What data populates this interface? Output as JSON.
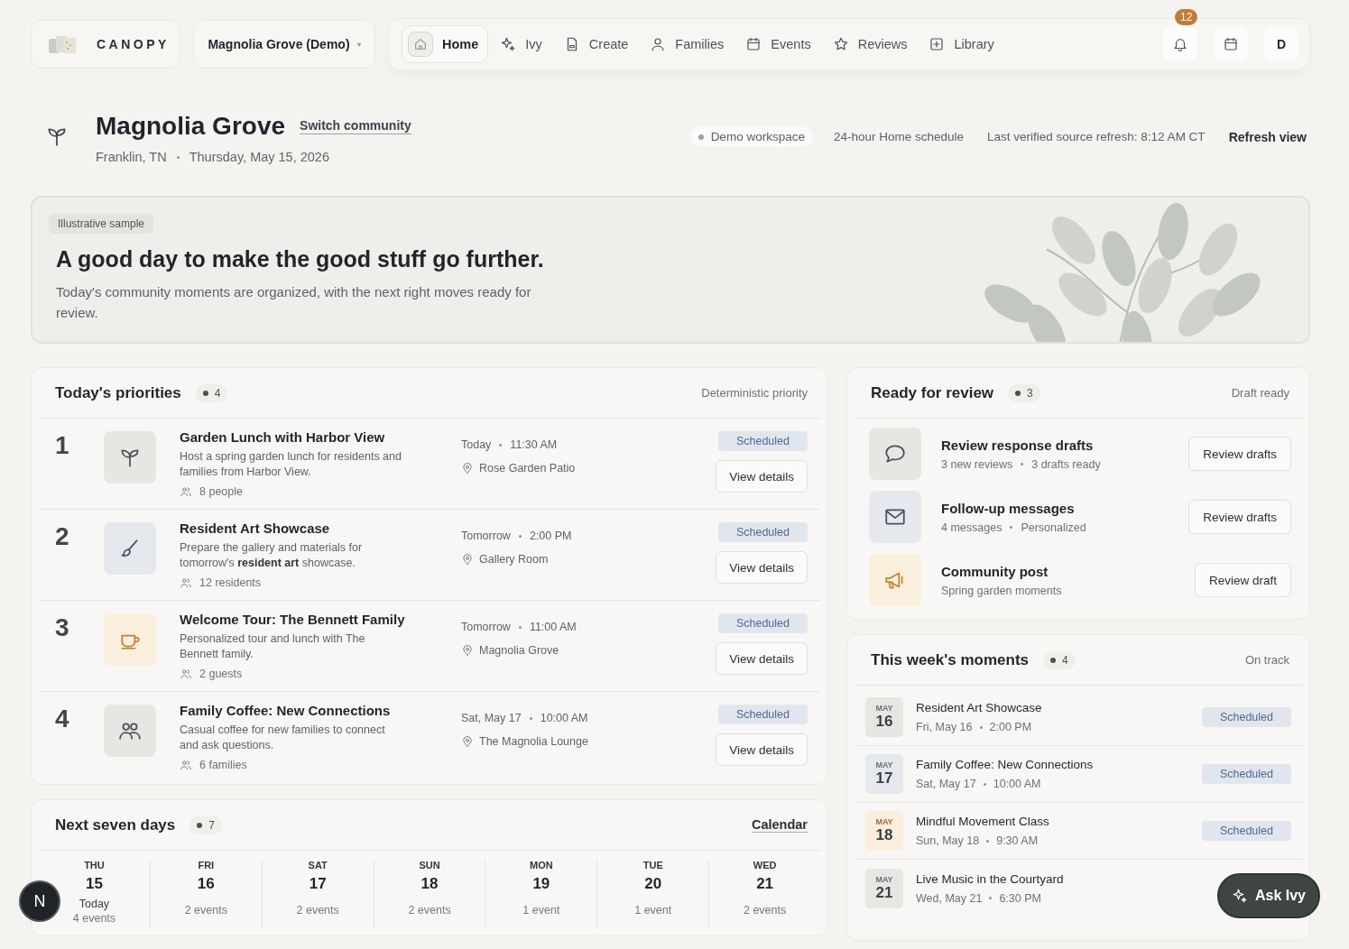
{
  "brand": {
    "name": "CANOPY"
  },
  "community_picker": {
    "label": "Magnolia Grove (Demo)",
    "caret": "▾"
  },
  "nav": [
    {
      "label": "Home",
      "selected": true
    },
    {
      "label": "Ivy",
      "selected": false
    },
    {
      "label": "Create",
      "selected": false
    },
    {
      "label": "Families",
      "selected": false
    },
    {
      "label": "Events",
      "selected": false
    },
    {
      "label": "Reviews",
      "selected": false
    },
    {
      "label": "Library",
      "selected": false
    }
  ],
  "top_actions": {
    "notifications_count": "12",
    "avatar": "D"
  },
  "page_header": {
    "title": "Magnolia Grove",
    "switch_link": "Switch community",
    "location": "Franklin, TN",
    "date": "Thursday, May 15, 2026",
    "workspace_chip": "Demo workspace",
    "schedule": "24-hour Home schedule",
    "refresh_info": "Last verified source refresh: 8:12 AM CT",
    "refresh_button": "Refresh view"
  },
  "hero": {
    "tag": "Illustrative sample",
    "headline": "A good day to make the good stuff go further.",
    "text": "Today's community moments are organized, with the next right moves ready for review."
  },
  "priorities": {
    "title": "Today's priorities",
    "count": "4",
    "note": "Deterministic priority",
    "items": [
      {
        "rank": "1",
        "title": "Garden Lunch with Harbor View",
        "description": "Host a spring garden lunch for residents and families from Harbor View.",
        "audience": "8 people",
        "day": "Today",
        "time": "11:30 AM",
        "place": "Rose Garden Patio",
        "status": "Scheduled",
        "action": "View details"
      },
      {
        "rank": "2",
        "title": "Resident Art Showcase",
        "description": "Prepare the gallery and materials for tomorrow's **resident art** showcase.",
        "audience": "12 residents",
        "day": "Tomorrow",
        "time": "2:00 PM",
        "place": "Gallery Room",
        "status": "Scheduled",
        "action": "View details"
      },
      {
        "rank": "3",
        "title": "Welcome Tour: The Bennett Family",
        "description": "Personalized tour and lunch with The Bennett family.",
        "audience": "2 guests",
        "day": "Tomorrow",
        "time": "11:00 AM",
        "place": "Magnolia Grove",
        "status": "Scheduled",
        "action": "View details"
      },
      {
        "rank": "4",
        "title": "Family Coffee: New Connections",
        "description": "Casual coffee for new families to connect and ask questions.",
        "audience": "6 families",
        "day": "Sat, May 17",
        "time": "10:00 AM",
        "place": "The Magnolia Lounge",
        "status": "Scheduled",
        "action": "View details"
      }
    ]
  },
  "next_seven_days": {
    "title": "Next seven days",
    "count": "7",
    "link": "Calendar",
    "days": [
      {
        "weekday": "THU",
        "date": "15",
        "note": "Today",
        "events": "4 events"
      },
      {
        "weekday": "FRI",
        "date": "16",
        "events": "2 events"
      },
      {
        "weekday": "SAT",
        "date": "17",
        "events": "2 events"
      },
      {
        "weekday": "SUN",
        "date": "18",
        "events": "2 events"
      },
      {
        "weekday": "MON",
        "date": "19",
        "events": "1 event"
      },
      {
        "weekday": "TUE",
        "date": "20",
        "events": "1 event"
      },
      {
        "weekday": "WED",
        "date": "21",
        "events": "2 events"
      }
    ]
  },
  "ready_for_review": {
    "title": "Ready for review",
    "count": "3",
    "note": "Draft ready",
    "items": [
      {
        "title": "Review response drafts",
        "details": [
          "3 new reviews",
          "3 drafts ready"
        ],
        "action": "Review drafts"
      },
      {
        "title": "Follow-up messages",
        "details": [
          "4 messages",
          "Personalized"
        ],
        "action": "Review drafts"
      },
      {
        "title": "Community post",
        "details": [
          "Spring garden moments"
        ],
        "action": "Review draft"
      }
    ]
  },
  "this_weeks_moments": {
    "title": "This week's moments",
    "count": "4",
    "note": "On track",
    "items": [
      {
        "month": "MAY",
        "day": "16",
        "title": "Resident Art Showcase",
        "when": "Fri, May 16",
        "time": "2:00 PM",
        "status": "Scheduled"
      },
      {
        "month": "MAY",
        "day": "17",
        "title": "Family Coffee: New Connections",
        "when": "Sat, May 17",
        "time": "10:00 AM",
        "status": "Scheduled"
      },
      {
        "month": "MAY",
        "day": "18",
        "title": "Mindful Movement Class",
        "when": "Sun, May 18",
        "time": "9:30 AM",
        "status": "Scheduled"
      },
      {
        "month": "MAY",
        "day": "21",
        "title": "Live Music in the Courtyard",
        "when": "Wed, May 21",
        "time": "6:30 PM"
      }
    ]
  },
  "ask_button": {
    "label": "Ask Ivy"
  },
  "dev_badge": {
    "label": "N"
  }
}
